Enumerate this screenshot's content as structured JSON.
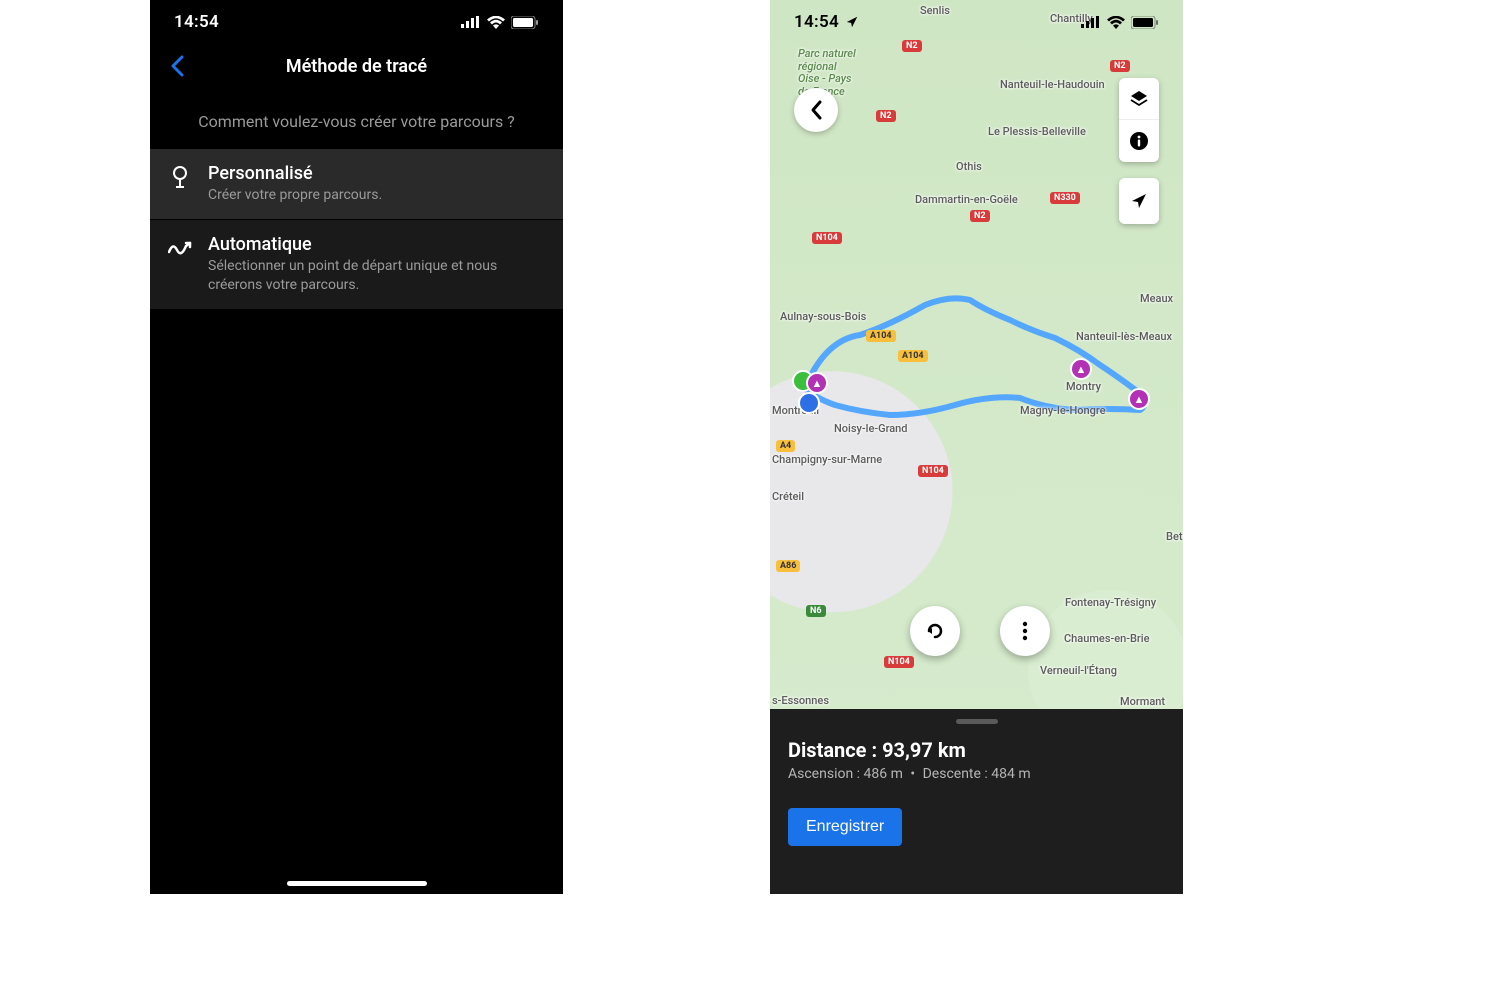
{
  "left": {
    "status": {
      "time": "14:54"
    },
    "nav": {
      "title": "Méthode de tracé"
    },
    "subheader": "Comment voulez-vous créer votre parcours ?",
    "options": [
      {
        "title": "Personnalisé",
        "desc": "Créer votre propre parcours."
      },
      {
        "title": "Automatique",
        "desc": "Sélectionner un point de départ unique et nous créerons votre parcours."
      }
    ]
  },
  "right": {
    "status": {
      "time": "14:54"
    },
    "map": {
      "places": {
        "senlis": "Senlis",
        "chantilly": "Chantilly",
        "parc": "Parc naturel\nrégional\nOise - Pays\nde France",
        "nanteuil": "Nanteuil-le-Haudouin",
        "plessis": "Le Plessis-Belleville",
        "othis": "Othis",
        "dammartin": "Dammartin-en-Goële",
        "aulnay": "Aulnay-sous-Bois",
        "meaux": "Meaux",
        "nanteuil_m": "Nanteuil-lès-Meaux",
        "montreuil": "Montreuil",
        "montry": "Montry",
        "magny": "Magny-le-Hongre",
        "noisy": "Noisy-le-Grand",
        "champigny": "Champigny-sur-Marne",
        "creteil": "Créteil",
        "bet": "Bet",
        "fontenay": "Fontenay-Trésigny",
        "chaumes": "Chaumes-en-Brie",
        "verneuil": "Verneuil-l'Étang",
        "mormant": "Mormant",
        "essonnes": "s-Essonnes"
      },
      "roads": {
        "n2a": "N2",
        "n2b": "N2",
        "n2c": "N2",
        "n2d": "N2",
        "n104a": "N104",
        "n104b": "N104",
        "n104c": "N104",
        "a4": "A4",
        "a86": "A86",
        "n6": "N6",
        "a104a": "A104",
        "a104b": "A104",
        "n330": "N330"
      }
    },
    "stats": {
      "distance_label": "Distance :",
      "distance_value": "93,97 km",
      "ascent_label": "Ascension :",
      "ascent_value": "486 m",
      "descent_label": "Descente :",
      "descent_value": "484 m",
      "separator": "•"
    },
    "save": "Enregistrer"
  }
}
